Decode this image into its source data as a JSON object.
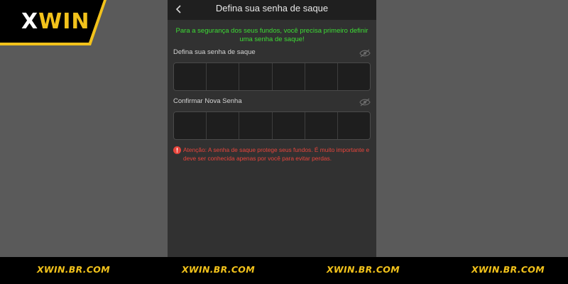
{
  "logo": {
    "part1": "X",
    "part2": "WIN"
  },
  "header": {
    "title": "Defina sua senha de saque",
    "back_icon": "chevron-left-icon"
  },
  "notice": "Para a segurança dos seus fundos, você precisa primeiro definir uma senha de saque!",
  "fields": [
    {
      "label": "Defina sua senha de saque",
      "icon": "eye-off-icon",
      "digits": 6
    },
    {
      "label": "Confirmar Nova Senha",
      "icon": "eye-off-icon",
      "digits": 6
    }
  ],
  "warning": {
    "icon": "alert-circle-icon",
    "text": "Atenção: A senha de saque protege seus fundos. É muito importante e deve ser conhecida apenas por você para evitar perdas."
  },
  "footer": [
    "XWIN.BR.COM",
    "XWIN.BR.COM",
    "XWIN.BR.COM",
    "XWIN.BR.COM"
  ],
  "colors": {
    "brand_yellow": "#f2c21b",
    "notice_green": "#3ddc35",
    "warning_red": "#e8453c",
    "panel_bg": "#313131",
    "page_bg": "#5a5a5a"
  }
}
